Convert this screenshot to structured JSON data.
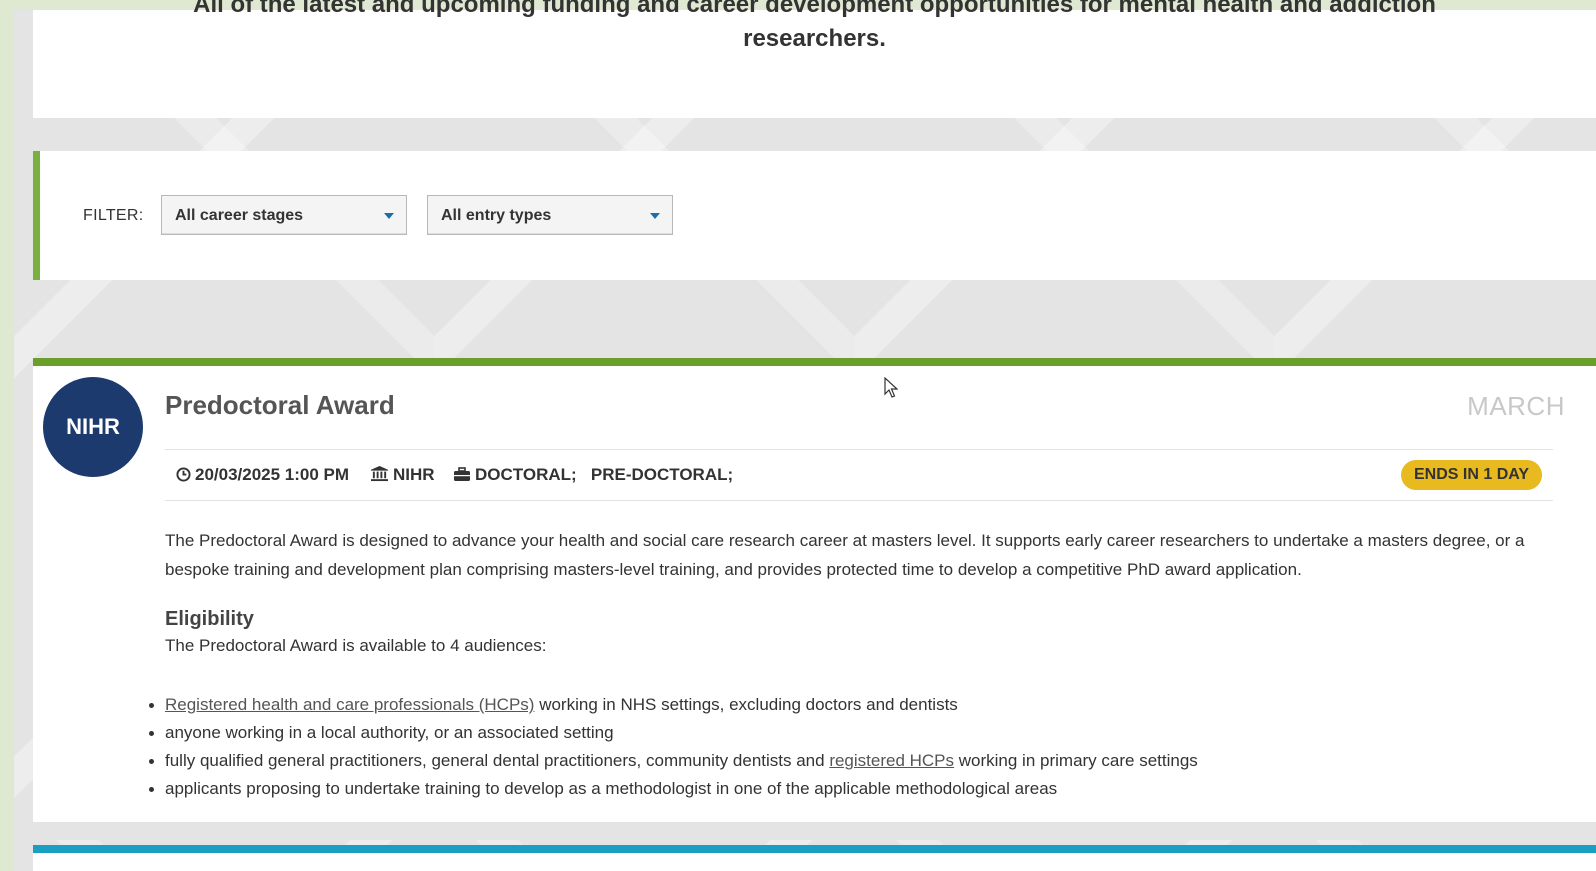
{
  "intro": {
    "text": "All of the latest and upcoming funding and career development opportunities for mental health and addiction researchers."
  },
  "filter": {
    "label": "FILTER:",
    "career_stage": "All career stages",
    "entry_type": "All entry types"
  },
  "opportunity": {
    "logo_text": "NIHR",
    "title": "Predoctoral Award",
    "month": "MARCH",
    "date": "20/03/2025 1:00 PM",
    "funder": "NIHR",
    "stage_1": "DOCTORAL;",
    "stage_2": "PRE-DOCTORAL;",
    "badge": "ENDS IN 1 DAY",
    "description": "The Predoctoral Award is designed to advance your health and social care research career at masters level. It supports early career researchers to undertake a masters degree, or a bespoke training and development plan comprising masters-level training, and provides protected time to develop a competitive PhD award application.",
    "eligibility_heading": "Eligibility",
    "eligibility_intro": "The Predoctoral Award is available to 4 audiences:",
    "audiences": {
      "a1_link": "Registered health and care professionals (HCPs)",
      "a1_rest": " working in NHS settings, excluding doctors and dentists",
      "a2": "anyone working in a local authority, or an associated setting",
      "a3_start": "fully qualified general practitioners, general dental practitioners, community dentists and ",
      "a3_link": "registered HCPs",
      "a3_rest": " working in primary care settings",
      "a4": "applicants proposing to undertake training to develop as a methodologist in one of the applicable methodological areas"
    }
  },
  "colors": {
    "accent_green": "#6a9f2c",
    "filter_border": "#7ab03f",
    "logo_bg": "#1d3a6e",
    "badge_bg": "#e9b920",
    "next_card_border": "#1a9fc3"
  }
}
